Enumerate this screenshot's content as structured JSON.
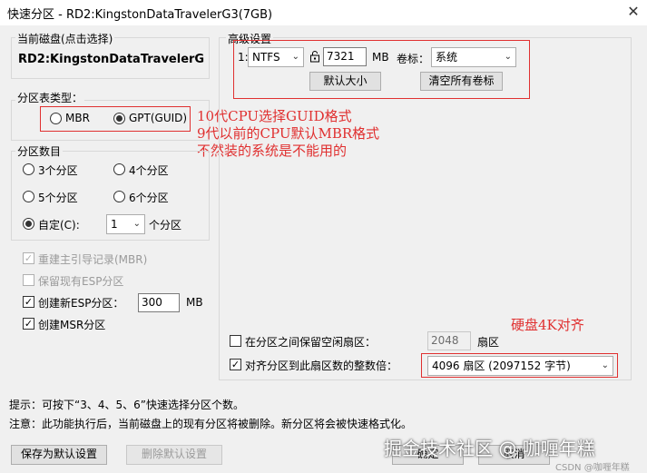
{
  "window": {
    "title": "快速分区 - RD2:KingstonDataTravelerG3(7GB)"
  },
  "disk": {
    "group_label": "当前磁盘(点击选择)",
    "name": "RD2:KingstonDataTravelerG3("
  },
  "partition_table": {
    "group_label": "分区表类型：",
    "mbr": "MBR",
    "gpt": "GPT(GUID)",
    "selected": "GPT(GUID)"
  },
  "annotation_left": {
    "line1": "10代CPU选择GUID格式",
    "line2": "9代以前的CPU默认MBR格式",
    "line3": "不然装的系统是不能用的"
  },
  "partition_count": {
    "group_label": "分区数目",
    "opt3": "3个分区",
    "opt4": "4个分区",
    "opt5": "5个分区",
    "opt6": "6个分区",
    "custom": "自定(C):",
    "custom_value": "1",
    "unit": "个分区"
  },
  "options": {
    "rebuild_mbr": "重建主引导记录(MBR)",
    "keep_esp": "保留现有ESP分区",
    "new_esp": "创建新ESP分区：",
    "esp_size": "300",
    "esp_unit": "MB",
    "create_msr": "创建MSR分区"
  },
  "advanced": {
    "group_label": "高级设置",
    "row_index": "1:",
    "fs": "NTFS",
    "size": "7321",
    "size_unit": "MB",
    "vol_label_label": "卷标：",
    "vol_label": "系统",
    "default_size_btn": "默认大小",
    "clear_labels_btn": "清空所有卷标"
  },
  "sector": {
    "reserve_label": "在分区之间保留空闲扇区：",
    "reserve_value": "2048",
    "reserve_unit": "扇区",
    "align_label": "对齐分区到此扇区数的整数倍：",
    "align_value": "4096 扇区 (2097152 字节)"
  },
  "annotation_right": "硬盘4K对齐",
  "hints": {
    "tip": "提示：可按下“3、4、5、6”快速选择分区个数。",
    "note": "注意：此功能执行后，当前磁盘上的现有分区将被删除。新分区将会被快速格式化。"
  },
  "buttons": {
    "save_default": "保存为默认设置",
    "delete_default": "删除默认设置",
    "ok": "确定",
    "cancel": "取消"
  },
  "watermark": {
    "main": "掘金技术社区 @ 咖喱年糕",
    "small": "CSDN @咖喱年糕"
  }
}
